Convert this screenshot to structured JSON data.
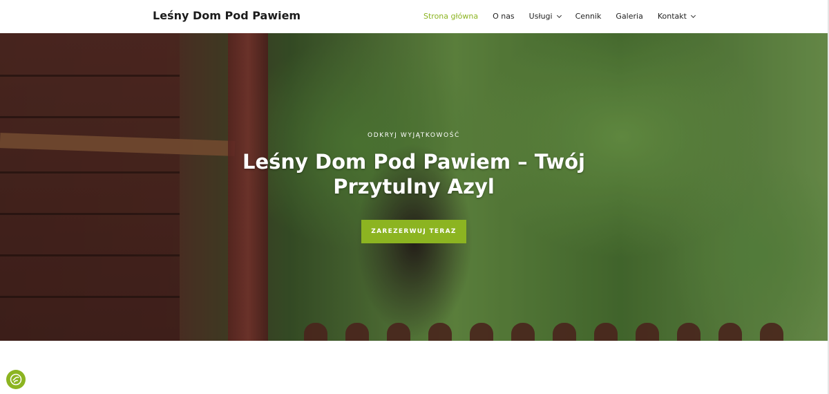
{
  "header": {
    "brand": "Leśny Dom Pod Pawiem",
    "nav": [
      {
        "label": "Strona główna",
        "active": true
      },
      {
        "label": "O nas"
      },
      {
        "label": "Usługi",
        "dropdown": true
      },
      {
        "label": "Cennik"
      },
      {
        "label": "Galeria"
      },
      {
        "label": "Kontakt",
        "dropdown": true
      }
    ]
  },
  "hero": {
    "eyebrow": "ODKRYJ WYJĄTKOWOŚĆ",
    "title": "Leśny Dom Pod Pawiem – Twój Przytulny Azyl",
    "cta": "ZAREZERWUJ TERAZ"
  },
  "consent": {
    "icon": "cookie-consent-icon"
  },
  "colors": {
    "accent": "#8cb421",
    "text": "#1c1c1c",
    "white": "#ffffff"
  }
}
